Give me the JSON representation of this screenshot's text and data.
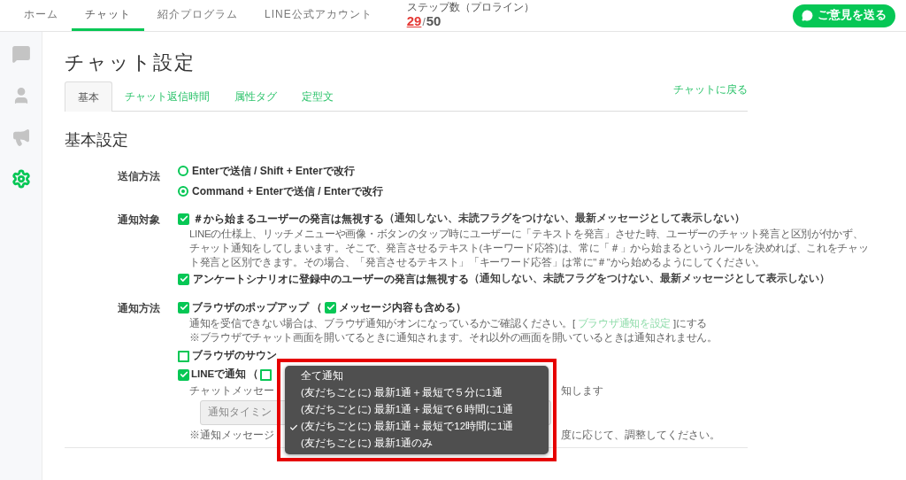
{
  "nav": {
    "tabs": [
      {
        "label": "ホーム",
        "selected": false
      },
      {
        "label": "チャット",
        "selected": true
      },
      {
        "label": "紹介プログラム",
        "selected": false
      },
      {
        "label": "LINE公式アカウント",
        "selected": false
      }
    ],
    "step_counter": {
      "label": "ステップ数（プロライン）",
      "used": "29",
      "separator": "/",
      "total": "50"
    },
    "feedback_button": "ご意見を送る"
  },
  "sidebar": {
    "items": [
      {
        "kind": "chat",
        "selected": false
      },
      {
        "kind": "user",
        "selected": false
      },
      {
        "kind": "megaphone",
        "selected": false
      },
      {
        "kind": "settings",
        "selected": true
      }
    ]
  },
  "page": {
    "title": "チャット設定",
    "back_link": "チャットに戻る",
    "tabs": [
      {
        "label": "基本",
        "selected": true
      },
      {
        "label": "チャット返信時間",
        "selected": false
      },
      {
        "label": "属性タグ",
        "selected": false
      },
      {
        "label": "定型文",
        "selected": false
      }
    ]
  },
  "section": {
    "title": "基本設定"
  },
  "send_method": {
    "label": "送信方法",
    "options": [
      {
        "label": "Enterで送信 / Shift + Enterで改行",
        "selected": false
      },
      {
        "label": "Command + Enterで送信 / Enterで改行",
        "selected": true
      }
    ]
  },
  "notify_target": {
    "label": "通知対象",
    "items": [
      {
        "label": "＃から始まるユーザーの発言は無視する",
        "note": "（通知しない、未読フラグをつけない、最新メッセージとして表示しない）",
        "checked": true,
        "description": [
          "LINEの仕様上、リッチメニューや画像・ボタンのタップ時にユーザーに「テキストを発言」させた時、ユーザーのチャット発言と区別が付かず、",
          "チャット通知をしてしまいます。そこで、発言させるテキスト(キーワード応答)は、常に「＃」から始まるというルールを決めれば、これをチャッ",
          "ト発言と区別できます。その場合、「発言させるテキスト」「キーワード応答」は常に\"＃\"から始めるようにしてください。"
        ]
      },
      {
        "label": "アンケートシナリオに登録中のユーザーの発言は無視する",
        "note": "（通知しない、未読フラグをつけない、最新メッセージとして表示しない）",
        "checked": true
      }
    ]
  },
  "notify_method": {
    "label": "通知方法",
    "popup": {
      "label": "ブラウザのポップアップ",
      "checked": true,
      "paren_open": "（",
      "sub_label": "メッセージ内容も含める",
      "sub_checked": true,
      "paren_close": "）",
      "note_before": "通知を受信できない場合は、ブラウザ通知がオンになっているかご確認ください。[",
      "note_link": "ブラウザ通知を設定",
      "note_after": "]にする",
      "note2": "※ブラウザでチャット画面を開いてるときに通知されます。それ以外の画面を開いているときは通知されません。"
    },
    "sound": {
      "label": "ブラウザのサウン",
      "checked": false
    },
    "line": {
      "label": "LINEで通知",
      "checked": true,
      "paren_open": "（",
      "sub_checked": false,
      "note_left": "チャットメッセー",
      "note_right": "知します",
      "select_placeholder": "通知タイミン",
      "footnote_left": "※通知メッセージ",
      "footnote_right": "度に応じて、調整してください。"
    }
  },
  "dropdown": {
    "highlighted": true,
    "options": [
      {
        "label": "全て通知",
        "selected": false
      },
      {
        "label": "(友だちごとに) 最新1通＋最短で５分に1通",
        "selected": false
      },
      {
        "label": "(友だちごとに) 最新1通＋最短で６時間に1通",
        "selected": false
      },
      {
        "label": "(友だちごとに) 最新1通＋最短で12時間に1通",
        "selected": true
      },
      {
        "label": "(友だちごとに) 最新1通のみ",
        "selected": false
      }
    ]
  }
}
